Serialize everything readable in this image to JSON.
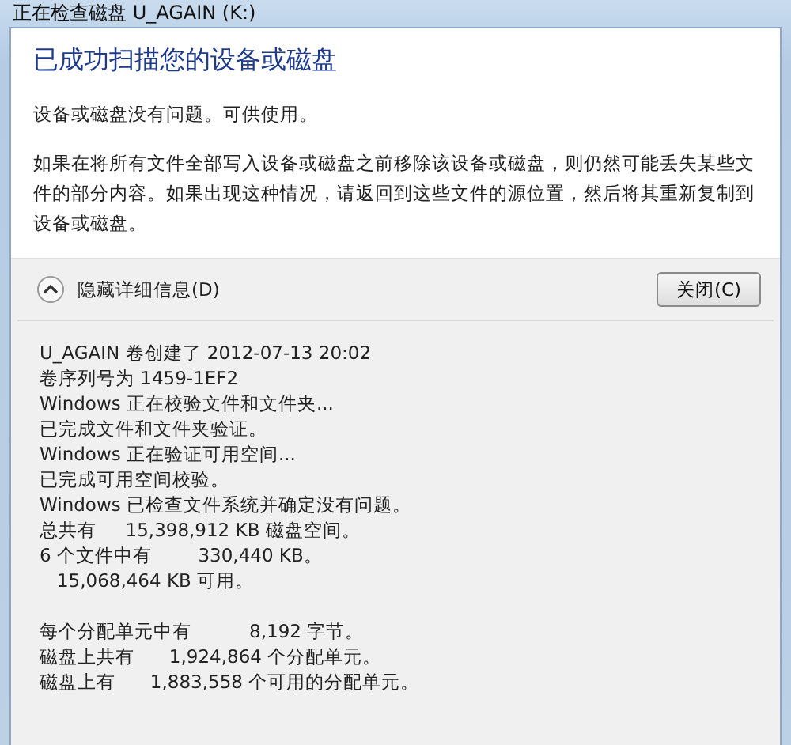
{
  "window": {
    "title": "正在检查磁盘 U_AGAIN (K:)"
  },
  "heading": "已成功扫描您的设备或磁盘",
  "paragraphs": [
    "设备或磁盘没有问题。可供使用。",
    "如果在将所有文件全部写入设备或磁盘之前移除该设备或磁盘，则仍然可能丢失某些文件的部分内容。如果出现这种情况，请返回到这些文件的源位置，然后将其重新复制到设备或磁盘。"
  ],
  "details_toggle": {
    "label": "隐藏详细信息(D)",
    "expanded": true
  },
  "close_button": "关闭(C)",
  "detail_groups": [
    [
      "U_AGAIN 卷创建了 2012-07-13 20:02",
      "卷序列号为 1459-1EF2",
      "Windows 正在校验文件和文件夹...",
      "已完成文件和文件夹验证。",
      "Windows 正在验证可用空间...",
      "已完成可用空间校验。",
      "Windows 已检查文件系统并确定没有问题。",
      "总共有     15,398,912 KB 磁盘空间。",
      "6 个文件中有        330,440 KB。",
      "   15,068,464 KB 可用。"
    ],
    [
      "每个分配单元中有          8,192 字节。",
      "磁盘上共有      1,924,864 个分配单元。",
      "磁盘上有      1,883,558 个可用的分配单元。"
    ]
  ]
}
